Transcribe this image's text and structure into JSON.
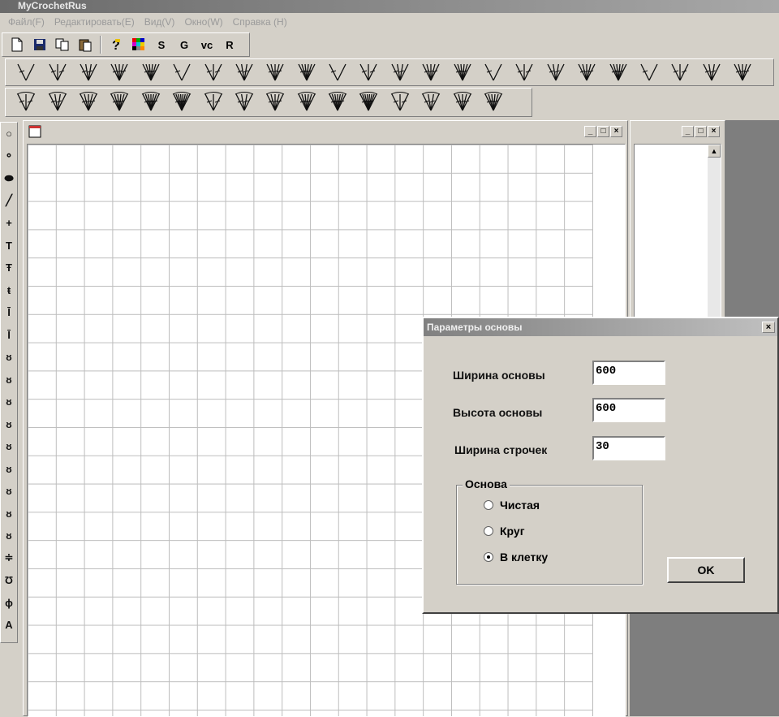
{
  "app": {
    "title": "MyCrochetRus"
  },
  "menu": {
    "items": [
      "Файл(F)",
      "Редактировать(E)",
      "Вид(V)",
      "Окно(W)",
      "Справка (H)"
    ]
  },
  "toolbar": {
    "buttons": [
      {
        "icon": "new-file-icon"
      },
      {
        "icon": "save-icon"
      },
      {
        "icon": "copy-icon"
      },
      {
        "icon": "paste-icon"
      },
      {
        "icon": "help-icon"
      },
      {
        "icon": "color-palette-icon"
      }
    ],
    "text_buttons": [
      "S",
      "G",
      "vc",
      "R"
    ]
  },
  "stitch_row1_count": 24,
  "stitch_row2_count": 16,
  "left_tools": [
    "○",
    "⚬",
    "⬬",
    "╱",
    "+",
    "T",
    "Ŧ",
    "ŧ",
    "Ī",
    "Ī",
    "ᴕ",
    "ᴕ",
    "ᴕ",
    "ᴕ",
    "ᴕ",
    "ᴕ",
    "ᴕ",
    "ᴕ",
    "ᴕ",
    "≑",
    "Ʊ",
    "ɸ",
    "A"
  ],
  "chart_window": {
    "buttons": {
      "minimize": "_",
      "maximize": "□",
      "close": "×"
    }
  },
  "side_window": {
    "buttons": {
      "minimize": "_",
      "maximize": "□",
      "close": "×"
    },
    "scroll_up": "▲"
  },
  "dialog": {
    "title": "Параметры основы",
    "close": "×",
    "width_label": "Ширина основы",
    "width_value": "600",
    "height_label": "Высота основы",
    "height_value": "600",
    "row_width_label": "Ширина строчек",
    "row_width_value": "30",
    "group_label": "Основа",
    "options": [
      {
        "label": "Чистая",
        "checked": false
      },
      {
        "label": "Круг",
        "checked": false
      },
      {
        "label": "В клетку",
        "checked": true
      }
    ],
    "ok_label": "OK"
  }
}
